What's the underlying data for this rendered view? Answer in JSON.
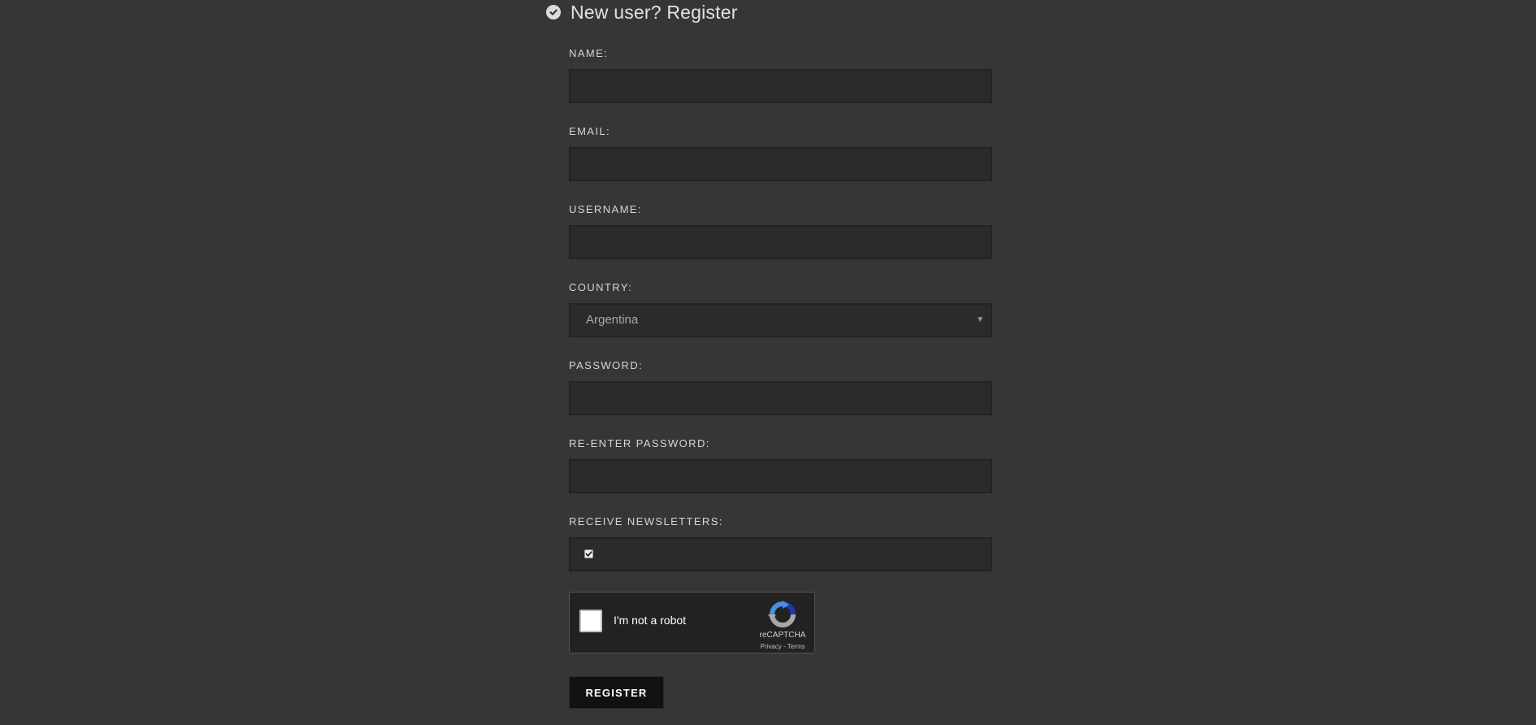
{
  "header": {
    "title": "New user? Register"
  },
  "form": {
    "name": {
      "label": "NAME:",
      "value": ""
    },
    "email": {
      "label": "EMAIL:",
      "value": ""
    },
    "username": {
      "label": "USERNAME:",
      "value": ""
    },
    "country": {
      "label": "COUNTRY:",
      "value": "Argentina"
    },
    "password": {
      "label": "PASSWORD:",
      "value": ""
    },
    "reenter_password": {
      "label": "RE-ENTER PASSWORD:",
      "value": ""
    },
    "newsletters": {
      "label": "RECEIVE NEWSLETTERS:",
      "checked": true
    }
  },
  "captcha": {
    "text": "I'm not a robot",
    "brand": "reCAPTCHA",
    "links": "Privacy - Terms"
  },
  "submit": {
    "label": "REGISTER"
  },
  "colors": {
    "background": "#363636",
    "input_background": "#2b2b2b",
    "button_background": "#111111"
  },
  "icons": {
    "title": "check-circle-icon",
    "select": "caret-down-icon",
    "captcha": "recaptcha-logo-icon"
  }
}
